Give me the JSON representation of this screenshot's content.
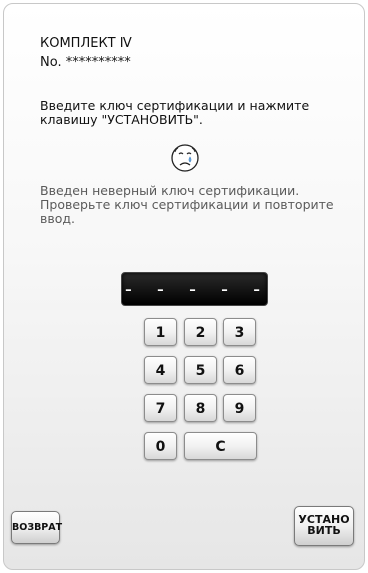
{
  "header": {
    "model": "КОМПЛЕКТ Ⅳ",
    "serial": "No. **********"
  },
  "instruction": "Введите ключ сертификации и нажмите\nклавишу \"УСТАНОВИТЬ\".",
  "error": {
    "icon": "sad-face-icon",
    "message": "Введен неверный ключ сертификации.\nПроверьте ключ сертификации и повторите\nввод."
  },
  "code_display": "- - - - - - - -",
  "keypad": {
    "k1": "1",
    "k2": "2",
    "k3": "3",
    "k4": "4",
    "k5": "5",
    "k6": "6",
    "k7": "7",
    "k8": "8",
    "k9": "9",
    "k0": "0",
    "clear": "C"
  },
  "buttons": {
    "back": "ВОЗВРАТ",
    "set": "УСТАНО\nВИТЬ"
  }
}
